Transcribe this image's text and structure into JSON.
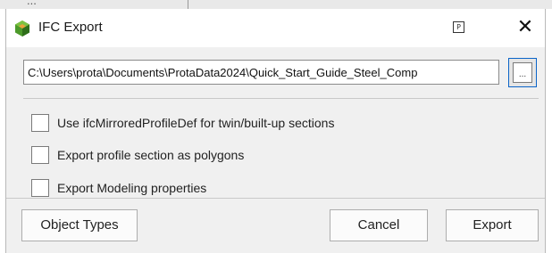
{
  "background": {
    "partial_text": "..."
  },
  "dialog": {
    "title": "IFC Export",
    "path_value": "C:\\Users\\prota\\Documents\\ProtaData2024\\Quick_Start_Guide_Steel_Comp",
    "browse_label": "...",
    "options": [
      {
        "label": "Use ifcMirroredProfileDef for twin/built-up sections",
        "checked": false
      },
      {
        "label": "Export profile section as polygons",
        "checked": false
      },
      {
        "label": "Export Modeling properties",
        "checked": false
      }
    ],
    "buttons": {
      "object_types": "Object Types",
      "cancel": "Cancel",
      "export": "Export"
    },
    "icons": {
      "app": "prota-app-icon",
      "pin": "pin-icon",
      "close": "close-icon"
    },
    "colors": {
      "app_icon": "#4c9a2a",
      "focus_border": "#0a64c8"
    }
  }
}
